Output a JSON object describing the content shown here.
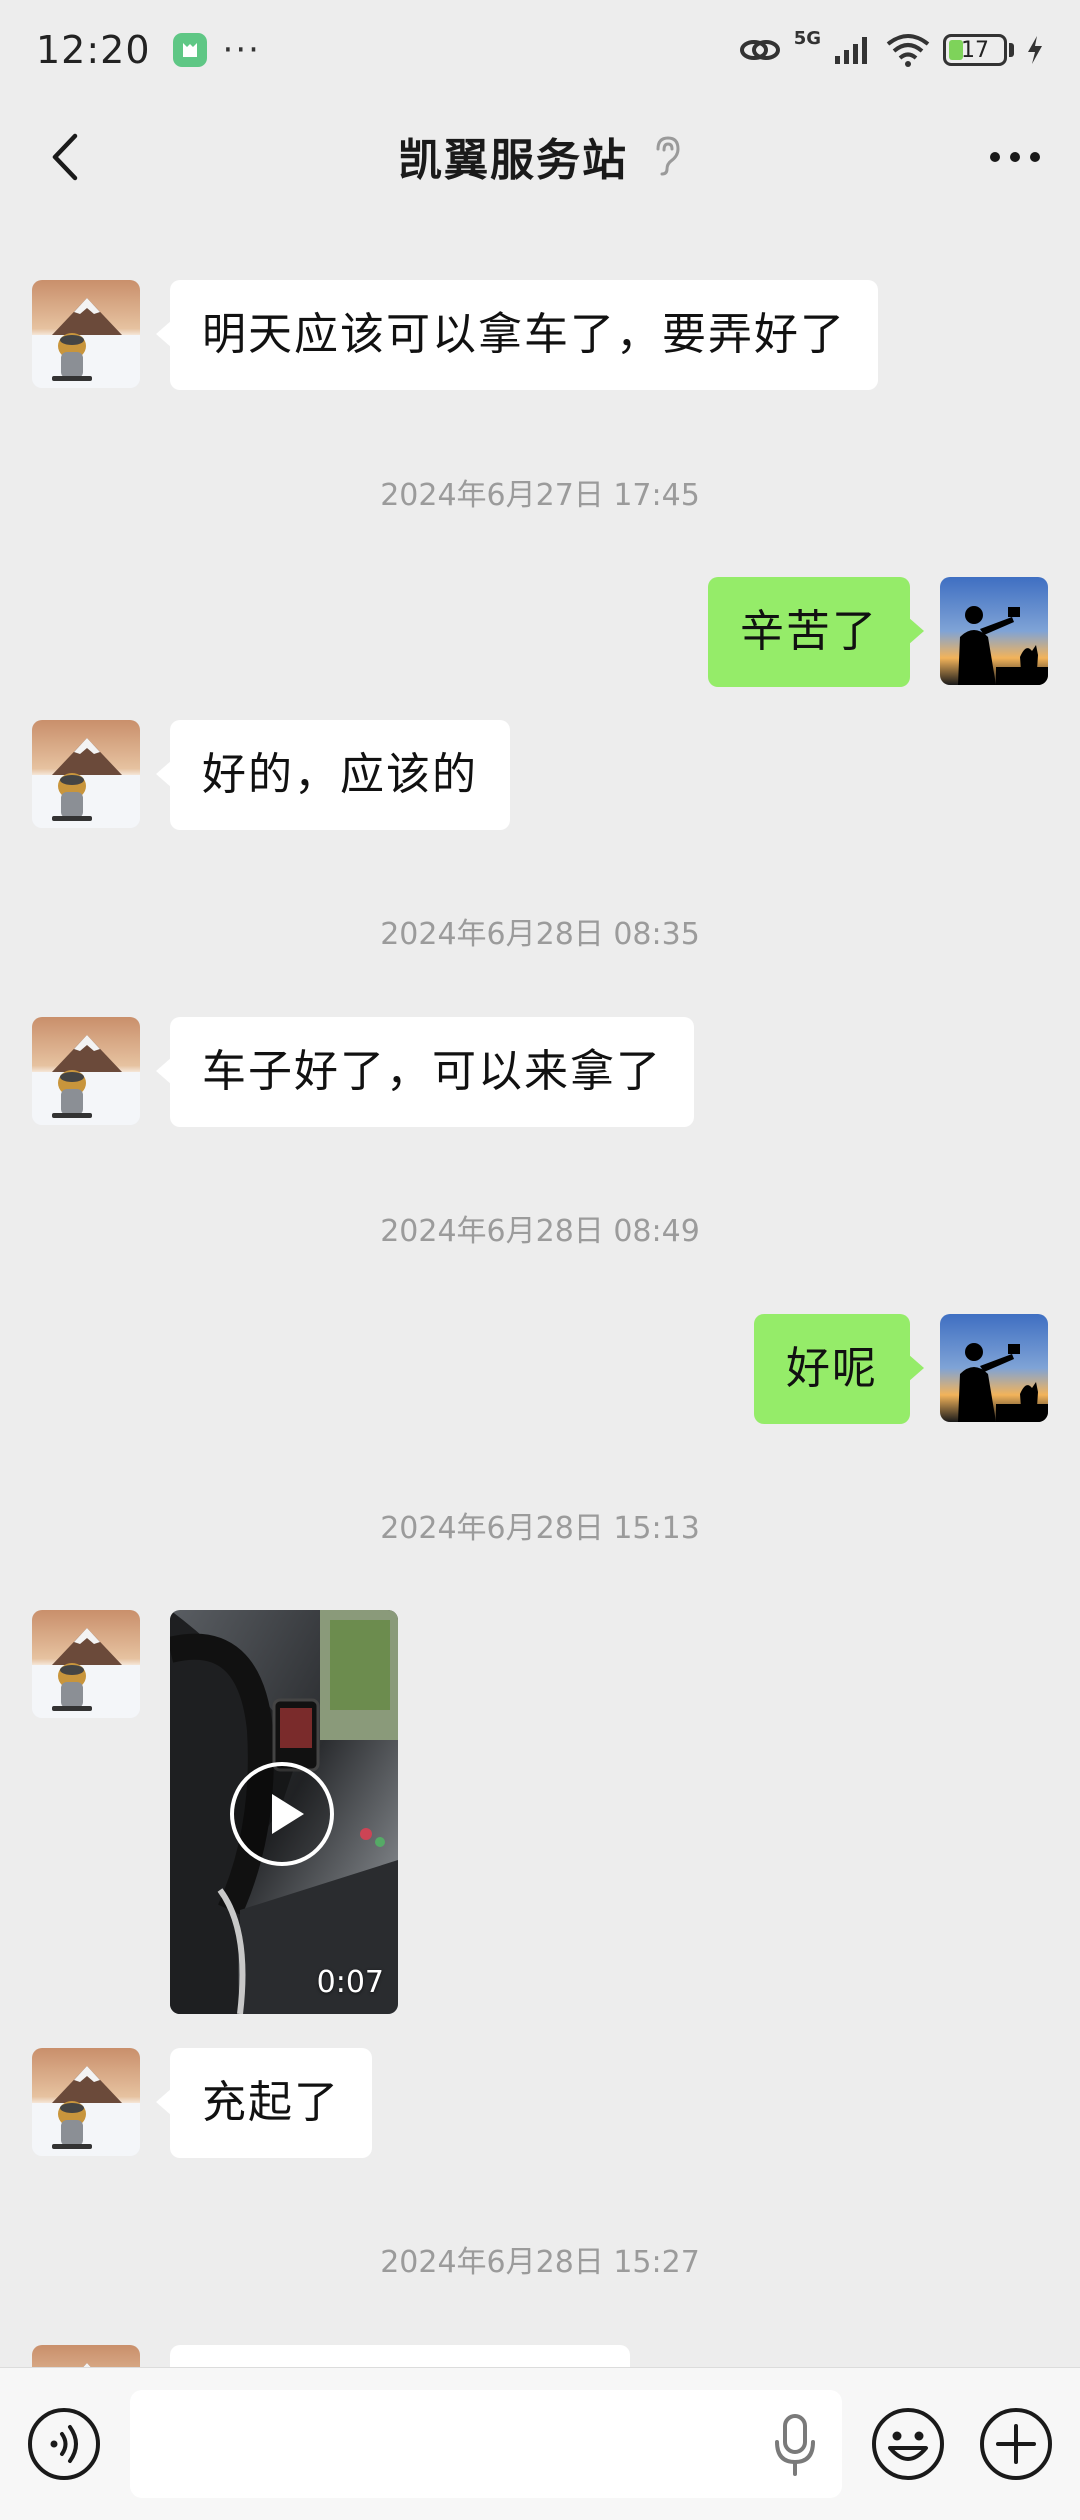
{
  "status_bar": {
    "time": "12:20",
    "network": "5G",
    "battery": "17"
  },
  "header": {
    "title": "凯翼服务站"
  },
  "messages": [
    {
      "type": "text",
      "side": "left",
      "text": "明天应该可以拿车了，要弄好了"
    },
    {
      "type": "time",
      "text": "2024年6月27日 17:45"
    },
    {
      "type": "text",
      "side": "right",
      "text": "辛苦了"
    },
    {
      "type": "text",
      "side": "left",
      "text": "好的，应该的"
    },
    {
      "type": "time",
      "text": "2024年6月28日 08:35"
    },
    {
      "type": "text",
      "side": "left",
      "text": "车子好了，可以来拿了"
    },
    {
      "type": "time",
      "text": "2024年6月28日 08:49"
    },
    {
      "type": "text",
      "side": "right",
      "text": "好呢"
    },
    {
      "type": "time",
      "text": "2024年6月28日 15:13"
    },
    {
      "type": "video",
      "side": "left",
      "duration": "0:07"
    },
    {
      "type": "text",
      "side": "left",
      "text": "充起了"
    },
    {
      "type": "time",
      "text": "2024年6月28日 15:27"
    }
  ],
  "input_bar": {
    "text_value": ""
  },
  "colors": {
    "background": "#ededed",
    "self_bubble": "#95ec69",
    "other_bubble": "#ffffff",
    "timestamp": "#9b9b9b"
  },
  "icons": [
    "back-icon",
    "ear-icon",
    "more-icon",
    "voice-icon",
    "mic-icon",
    "emoji-icon",
    "plus-icon",
    "play-icon"
  ]
}
